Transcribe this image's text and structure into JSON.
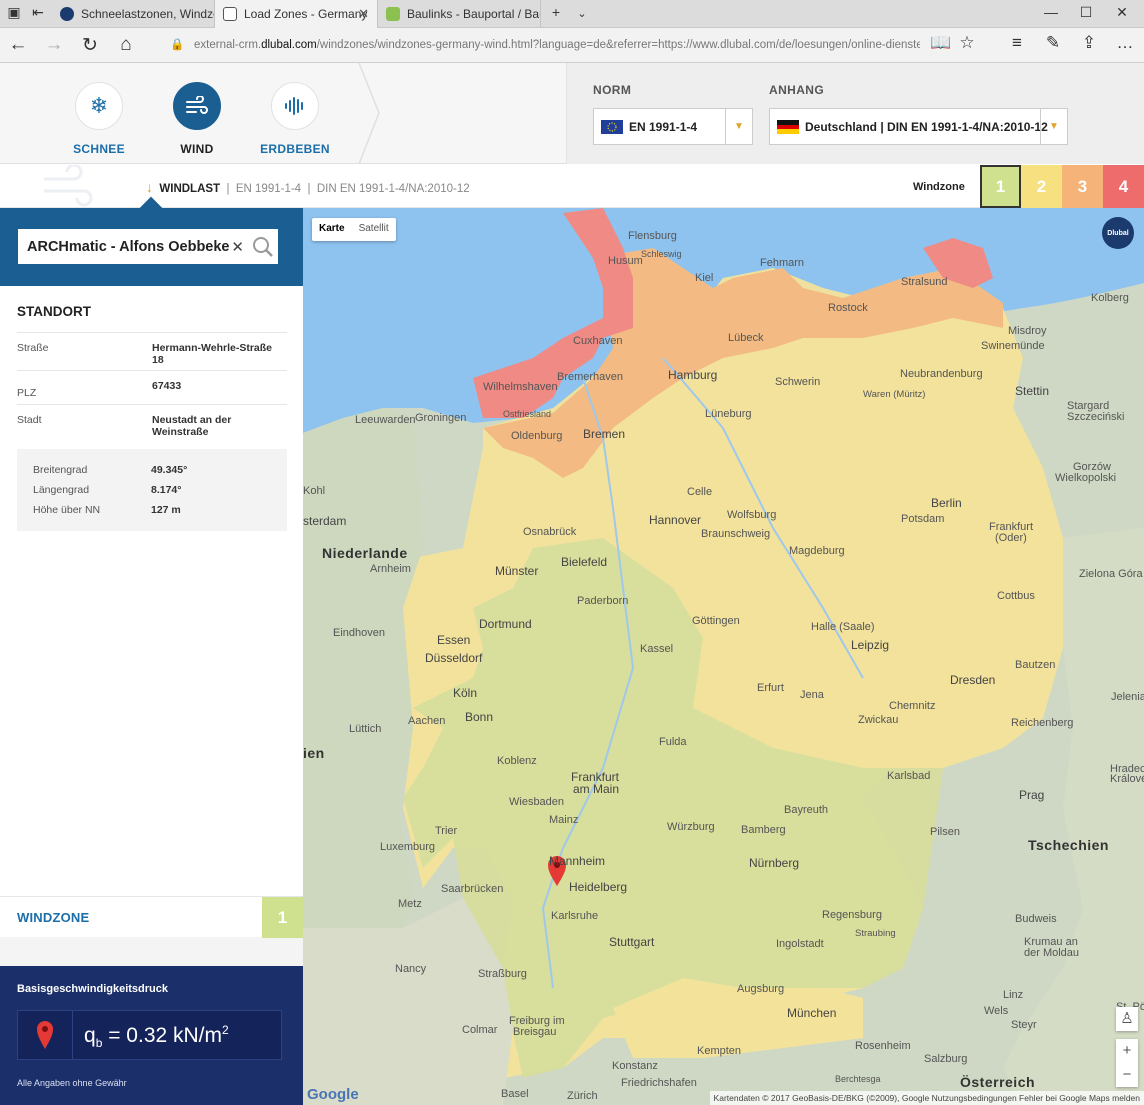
{
  "browser": {
    "tabs": [
      {
        "title": "Schneelastzonen, Windzo",
        "active": false
      },
      {
        "title": "Load Zones - Germany",
        "active": true
      },
      {
        "title": "Baulinks - Bauportal / Baum",
        "active": false
      }
    ],
    "url_prefix": "external-crm.",
    "url_domain": "dlubal.com",
    "url_rest": "/windzones/windzones-germany-wind.html?language=de&referrer=https://www.dlubal.com/de/loesungen/online-dienste/schnee"
  },
  "categories": [
    {
      "label": "SCHNEE",
      "icon": "snowflake-icon",
      "active": false
    },
    {
      "label": "WIND",
      "icon": "wind-icon",
      "active": true
    },
    {
      "label": "ERDBEBEN",
      "icon": "seismic-icon",
      "active": false
    }
  ],
  "norm": {
    "label": "NORM",
    "value": "EN 1991-1-4",
    "flag": "eu-flag-icon"
  },
  "anhang": {
    "label": "ANHANG",
    "value": "Deutschland | DIN EN 1991-1-4/NA:2010-12",
    "flag": "germany-flag-icon"
  },
  "windlast": {
    "title": "WINDLAST",
    "norm": "EN 1991-1-4",
    "na": "DIN EN 1991-1-4/NA:2010-12"
  },
  "zones": {
    "label": "Windzone",
    "items": [
      {
        "n": "1",
        "color": "#cfe08f"
      },
      {
        "n": "2",
        "color": "#f7e07f"
      },
      {
        "n": "3",
        "color": "#f5b37a"
      },
      {
        "n": "4",
        "color": "#ef6c6c"
      }
    ]
  },
  "search": {
    "value": "ARCHmatic - Alfons Oebbeke"
  },
  "standort": {
    "title": "STANDORT",
    "rows": [
      {
        "key": "Straße",
        "value": "Hermann-Wehrle-Straße 18"
      },
      {
        "key": "PLZ",
        "value": "67433"
      },
      {
        "key": "Stadt",
        "value": "Neustadt an der Weinstraße"
      }
    ],
    "coords": [
      {
        "key": "Breitengrad",
        "value": "49.345°"
      },
      {
        "key": "Längengrad",
        "value": "8.174°"
      },
      {
        "key": "Höhe über NN",
        "value": "127 m"
      }
    ]
  },
  "windzone": {
    "label": "WINDZONE",
    "value": "1"
  },
  "basis": {
    "title": "Basisgeschwindigkeitsdruck",
    "symbol": "q",
    "sub": "b",
    "value": " = 0.32 kN/m",
    "sup": "2",
    "note": "Alle Angaben ohne Gewähr"
  },
  "map": {
    "types": [
      "Karte",
      "Satellit"
    ],
    "logo": "Dlubal",
    "attribution": "Kartendaten © 2017 GeoBasis-DE/BKG (©2009), Google   Nutzungsbedingungen   Fehler bei Google Maps melden",
    "google": "Google",
    "labels": {
      "flensburg": "Flensburg",
      "husum": "Husum",
      "kiel": "Kiel",
      "fehmarn": "Fehmarn",
      "rostock": "Rostock",
      "stralsund": "Stralsund",
      "kolberg": "Kolberg",
      "cuxhaven": "Cuxhaven",
      "luebeck": "Lübeck",
      "hamburg": "Hamburg",
      "schwerin": "Schwerin",
      "neubrandenburg": "Neubrandenburg",
      "stettin": "Stettin",
      "bremerhaven": "Bremerhaven",
      "wilhelmshaven": "Wilhelmshaven",
      "bremen": "Bremen",
      "oldenburg": "Oldenburg",
      "groningen": "Groningen",
      "leeuwarden": "Leeuwarden",
      "lueneburg": "Lüneburg",
      "berlin": "Berlin",
      "potsdam": "Potsdam",
      "hannover": "Hannover",
      "wolfsburg": "Wolfsburg",
      "braunschweig": "Braunschweig",
      "magdeburg": "Magdeburg",
      "celle": "Celle",
      "niederlande": "Niederlande",
      "arnheim": "Arnheim",
      "amsterdam": "sterdam",
      "bielefeld": "Bielefeld",
      "muenster": "Münster",
      "osnabrueck": "Osnabrück",
      "paderborn": "Paderborn",
      "dortmund": "Dortmund",
      "essen": "Essen",
      "duesseldorf": "Düsseldorf",
      "eindhoven": "Eindhoven",
      "goettingen": "Göttingen",
      "kassel": "Kassel",
      "halle": "Halle (Saale)",
      "leipzig": "Leipzig",
      "cottbus": "Cottbus",
      "dresden": "Dresden",
      "bautzen": "Bautzen",
      "erfurt": "Erfurt",
      "jena": "Jena",
      "chemnitz": "Chemnitz",
      "zwickau": "Zwickau",
      "koeln": "Köln",
      "bonn": "Bonn",
      "aachen": "Aachen",
      "luettich": "Lüttich",
      "koblenz": "Koblenz",
      "fulda": "Fulda",
      "frankfurt": "Frankfurt",
      "frankfurt2": "am Main",
      "wiesbaden": "Wiesbaden",
      "mainz": "Mainz",
      "trier": "Trier",
      "luxemburg": "Luxemburg",
      "wuerzburg": "Würzburg",
      "bayreuth": "Bayreuth",
      "bamberg": "Bamberg",
      "mannheim": "Mannheim",
      "heidelberg": "Heidelberg",
      "saarbruecken": "Saarbrücken",
      "karlsruhe": "Karlsruhe",
      "nuernberg": "Nürnberg",
      "pilsen": "Pilsen",
      "prag": "Prag",
      "tschechien": "Tschechien",
      "metz": "Metz",
      "nancy": "Nancy",
      "stuttgart": "Stuttgart",
      "regensburg": "Regensburg",
      "ingolstadt": "Ingolstadt",
      "strassburg": "Straßburg",
      "augsburg": "Augsburg",
      "muenchen": "München",
      "rosenheim": "Rosenheim",
      "linz": "Linz",
      "freiburg": "Freiburg im",
      "freiburg2": "Breisgau",
      "colmar": "Colmar",
      "konstanz": "Konstanz",
      "kempten": "Kempten",
      "salzburg": "Salzburg",
      "oesterreich": "Österreich",
      "basel": "Basel",
      "zuerich": "Zürich",
      "budweis": "Budweis",
      "karlsbad": "Karlsbad",
      "reichenberg": "Reichenberg",
      "zielona": "Zielona Góra",
      "gorzow": "Gorzów",
      "gorzow2": "Wielkopolski",
      "stargard": "Stargard",
      "stargard2": "Szczeciński",
      "misdroy": "Misdroy",
      "swinemuende": "Swinemünde",
      "waren": "Waren (Müritz)",
      "frankfurtoder": "Frankfurt",
      "frankfurtoder2": "(Oder)",
      "wels": "Wels",
      "steyr": "Steyr",
      "poelten": "St. Pölten",
      "jelenia": "Jelenia Gór",
      "hradec": "Hradec",
      "kralove": "Králové",
      "krumau": "Krumau an",
      "krumau2": "der Moldau",
      "straubing": "Straubing",
      "berchtesgaden": "Berchtesga",
      "friedrichshafen": "Friedrichshafen",
      "schleswig": "Schleswig",
      "ostfriesland": "Ostfriesland",
      "kohl": "Kohl"
    }
  }
}
